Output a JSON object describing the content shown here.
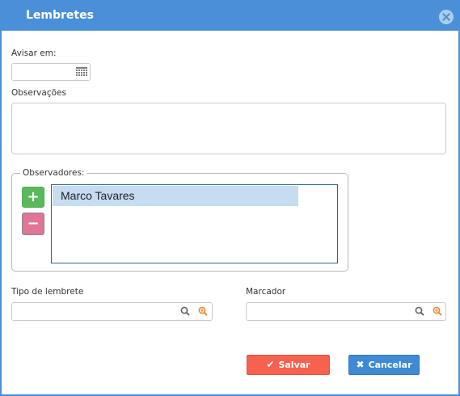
{
  "dialog": {
    "title": "Lembretes"
  },
  "fields": {
    "avisar_label": "Avisar em:",
    "avisar_value": "",
    "observacoes_label": "Observações",
    "observacoes_value": ""
  },
  "observers": {
    "legend": "Observadores:",
    "add_label": "+",
    "remove_label": "−",
    "items": [
      {
        "name": "Marco Tavares"
      }
    ]
  },
  "tipo": {
    "label": "Tipo de lembrete",
    "value": ""
  },
  "marcador": {
    "label": "Marcador",
    "value": ""
  },
  "actions": {
    "save_label": "Salvar",
    "save_glyph": "✔",
    "cancel_label": "Cancelar",
    "cancel_glyph": "✖"
  },
  "colors": {
    "titlebar": "#4a90d9",
    "add_button": "#5cb85c",
    "remove_button": "#e07595",
    "save_button": "#f76150",
    "cancel_button": "#3f8ad3",
    "selection": "#c5dcf1"
  }
}
